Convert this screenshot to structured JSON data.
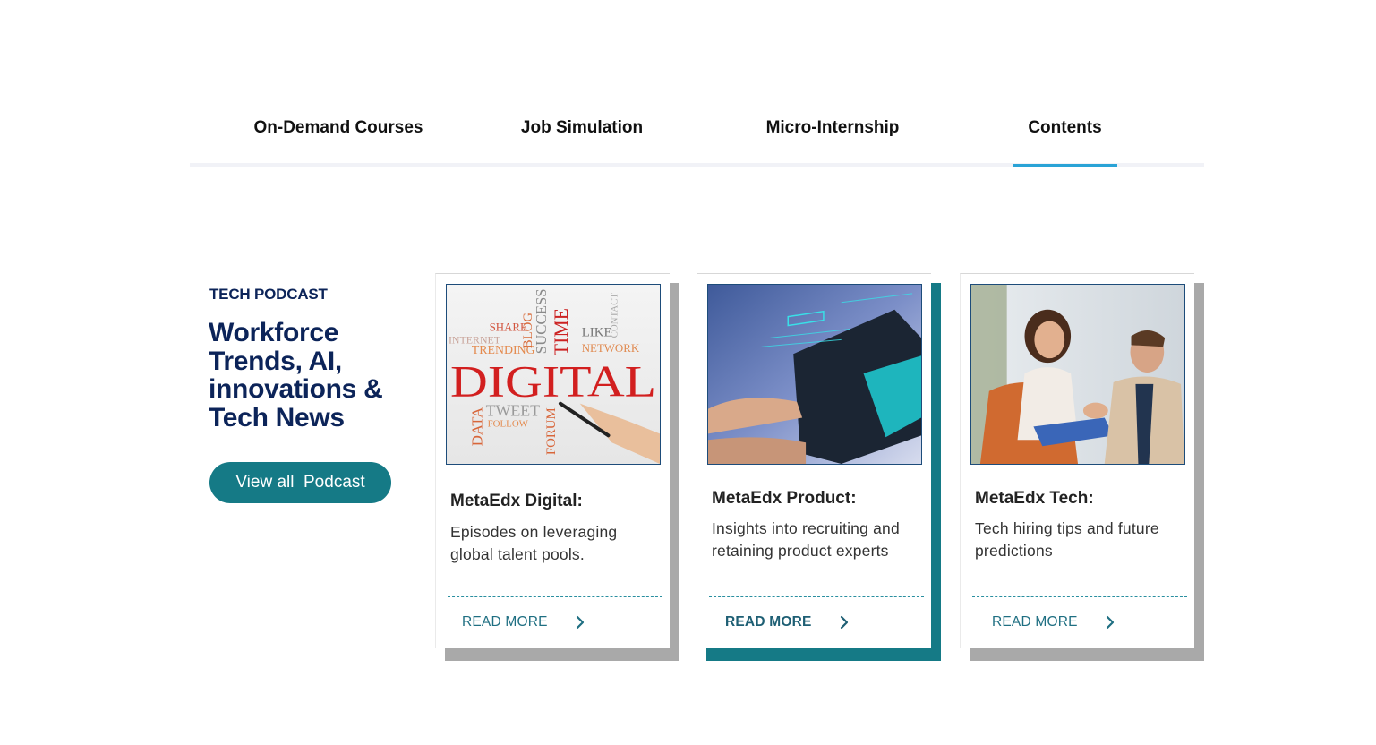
{
  "tabs": [
    {
      "label": "On-Demand Courses",
      "active": false
    },
    {
      "label": "Job Simulation",
      "active": false
    },
    {
      "label": "Micro-Internship",
      "active": false
    },
    {
      "label": "Contents",
      "active": true
    }
  ],
  "intro": {
    "eyebrow": "TECH PODCAST",
    "headline": "Workforce Trends, AI, innovations & Tech News",
    "button_label": "View all  Podcast"
  },
  "cards": [
    {
      "title": "MetaEdx Digital:",
      "description": "Episodes on leveraging global talent pools.",
      "link_label": "READ MORE",
      "image": "digital-word-cloud-image",
      "highlighted": false
    },
    {
      "title": "MetaEdx Product:",
      "description": "Insights into recruiting and retaining product experts",
      "link_label": "READ MORE",
      "image": "tablet-touch-image",
      "highlighted": true
    },
    {
      "title": "MetaEdx Tech:",
      "description": "Tech hiring tips and future predictions",
      "link_label": "READ MORE",
      "image": "handshake-meeting-image",
      "highlighted": false
    }
  ],
  "word_cloud": {
    "main": "DIGITAL",
    "words": [
      "SHARE",
      "INTERNET",
      "TRENDING",
      "BLOG",
      "SUCCESS",
      "TIME",
      "LIKE",
      "NETWORK",
      "TWEET",
      "DATA",
      "FORUM",
      "FOLLOW",
      "CONTACT"
    ]
  },
  "icons": {
    "chevron": "chevron-right-icon"
  },
  "colors": {
    "brand_navy": "#0c2459",
    "brand_teal": "#157a86",
    "tab_underline": "#2aa3d6",
    "shadow_gray": "#a9a9a9"
  }
}
